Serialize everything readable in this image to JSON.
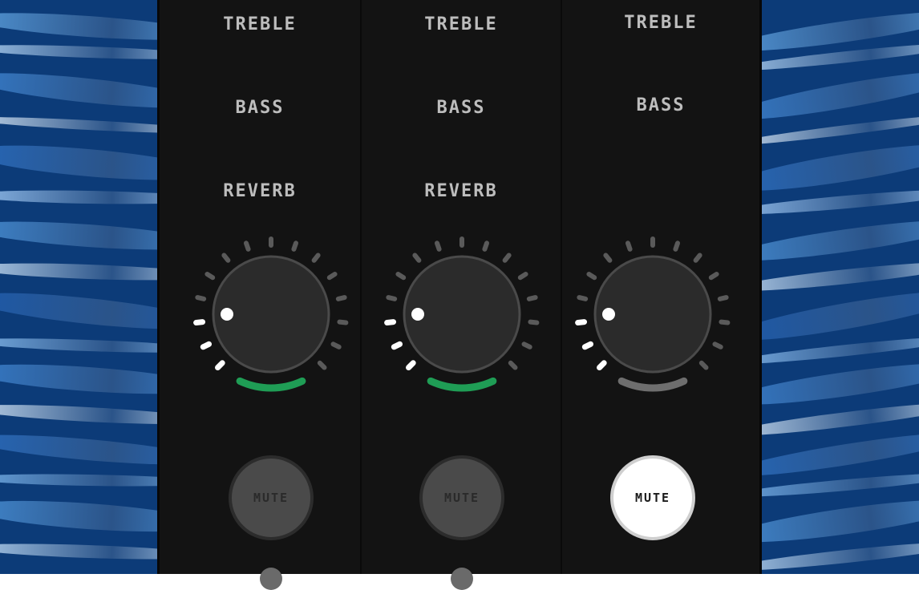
{
  "channels": [
    {
      "treble_label": "TREBLE",
      "bass_label": "BASS",
      "reverb_label": "REVERB",
      "mute_label": "MUTE",
      "mute_active": false,
      "knob_level": 0.1,
      "arc_color": "#1f9d55"
    },
    {
      "treble_label": "TREBLE",
      "bass_label": "BASS",
      "reverb_label": "REVERB",
      "mute_label": "MUTE",
      "mute_active": false,
      "knob_level": 0.1,
      "arc_color": "#1f9d55"
    },
    {
      "treble_label": "TREBLE",
      "bass_label": "BASS",
      "mute_label": "MUTE",
      "mute_active": true,
      "knob_level": 0.1,
      "arc_color": "#6e6e6e"
    }
  ],
  "colors": {
    "panel": "#131313",
    "background_blue": "#0c3b78",
    "tick_lit": "#ffffff",
    "tick_unlit": "#5a5a5a",
    "knob": "#2b2b2b"
  }
}
